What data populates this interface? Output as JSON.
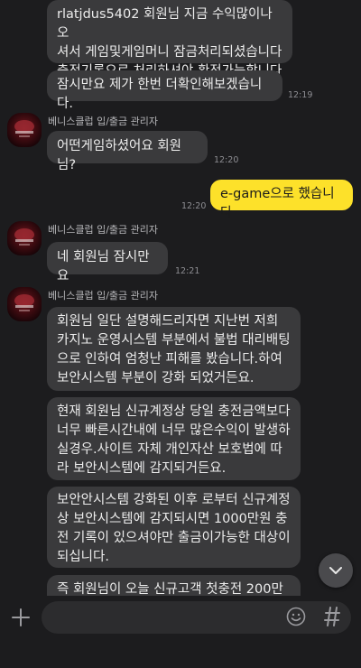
{
  "sender_name": "베니스클럽 입/출금 관리자",
  "messages": {
    "m1": "rlatjdus5402 회원님 지금 수익많이나오\n셔서 게임및게임머니 잠금처리되셨습니다\n충전기록으로 처리하셔야 환전가능합니다",
    "m2": "잠시만요 제가 한번 더확인해보겠습니다.",
    "m2_time": "12:19",
    "m3": "어떤게임하셨어요 회원님?",
    "m3_time": "12:20",
    "m4": "e-game으로 했습니다",
    "m4_time": "12:20",
    "m5": "네 회원님 잠시만요",
    "m5_time": "12:21",
    "m6": "회원님 일단 설명해드리자면 지난번 저희\n카지노 운영시스템 부분에서 불법 대리배팅\n으로 인하여 엄청난 피해를 봤습니다.하여\n보안시스템 부분이 강화 되었거든요.",
    "m7": "현재 회원님 신규계정상 당일 충전금액보다\n너무 빠른시간내에 너무 많은수익이 발생하\n실경우.사이트 자체 개인자산 보호법에 따\n라 보안시스템에 감지되거든요.",
    "m8": "보안안시스템 강화된 이후 로부터 신규계정\n상  보안시스템에 감지되시면 1000만원 충\n전 기록이 있으셔야만 출금이가능한 대상이\n되십니다.",
    "m9": "즉 회원님이 오늘 신규고객 첫충전 200만"
  },
  "input": {
    "placeholder": ""
  },
  "icons": {
    "plus": "plus-icon",
    "emoji": "emoji-icon",
    "hash": "hash-icon",
    "scroll": "chevron-down-icon"
  },
  "colors": {
    "background": "#1c1c1e",
    "bubble_other": "#3a3a3c",
    "bubble_me": "#fde12a"
  }
}
